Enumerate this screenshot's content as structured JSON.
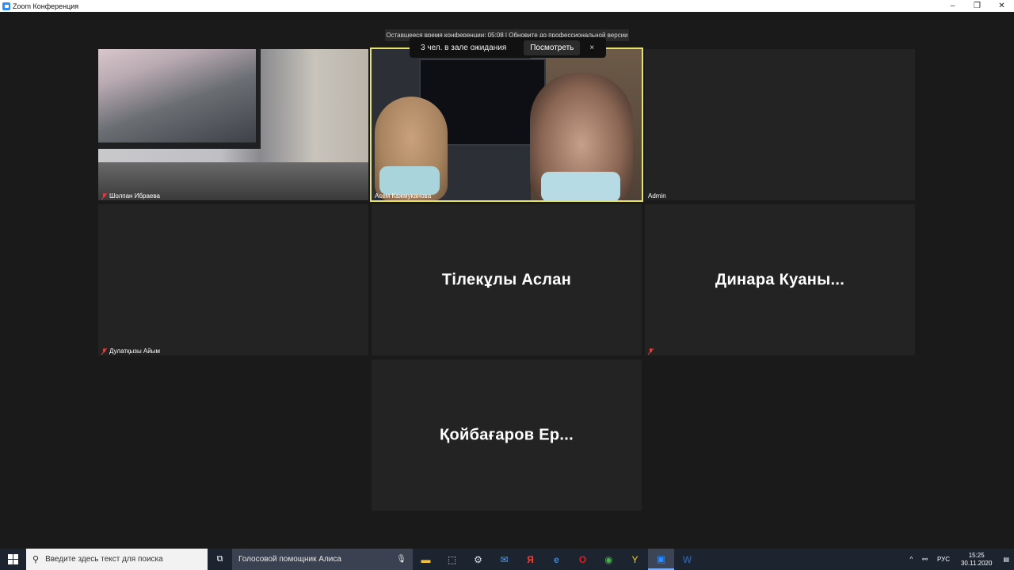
{
  "window": {
    "title": "Zoom Конференция",
    "minimize": "–",
    "restore": "❐",
    "close": "✕"
  },
  "banner": {
    "text": "Оставшееся время конференции: 05:08 | Обновите до профессиональной версии"
  },
  "waiting_room": {
    "text": "3 чел. в зале ожидания",
    "view_button": "Посмотреть",
    "close": "×"
  },
  "participants": [
    {
      "name": "Шолпан Ибраева",
      "muted": true,
      "video": true
    },
    {
      "name": "Асем Кажмуканова",
      "muted": false,
      "video": true,
      "active": true
    },
    {
      "name": "Admin",
      "muted": false,
      "video": false
    },
    {
      "name": "Дулатқызы Айым",
      "muted": true,
      "video": false
    },
    {
      "name": "",
      "display_name": "Тілекұлы Аслан",
      "muted": false,
      "video": false
    },
    {
      "name": "",
      "display_name": "Динара  Куаны...",
      "muted": true,
      "video": false
    },
    {
      "name": "",
      "display_name": "Қойбағаров Ер...",
      "muted": false,
      "video": false
    }
  ],
  "taskbar": {
    "start_icon": "windows-logo",
    "search_placeholder": "Введите здесь текст для поиска",
    "assistant_label": "Голосовой помощник Алиса",
    "tray_language": "РУС",
    "time": "15:25",
    "date": "30.11.2020"
  },
  "colors": {
    "active_speaker": "#e6e36a",
    "muted_icon": "#e04040",
    "zoom_blue": "#2d8cff"
  }
}
